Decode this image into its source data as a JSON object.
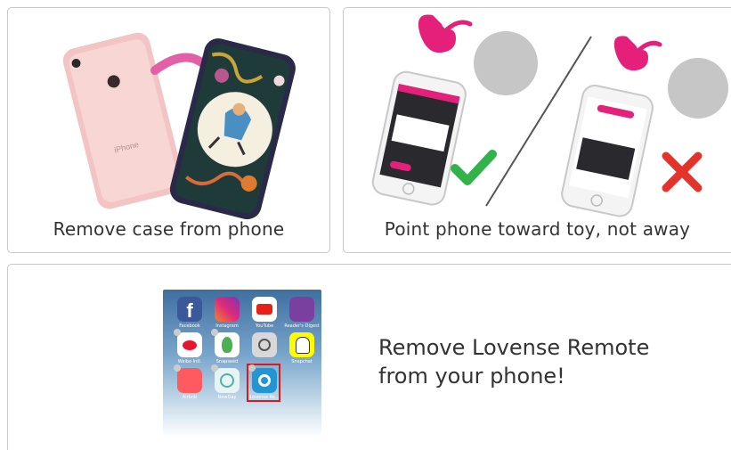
{
  "tips": [
    {
      "caption": "Remove case from phone"
    },
    {
      "caption": "Point phone toward toy, not away"
    }
  ],
  "notice": {
    "message_line1": "Remove Lovense Remote",
    "message_line2": "from your phone!"
  },
  "app_grid": {
    "apps": [
      {
        "label": "Facebook"
      },
      {
        "label": "Instagram"
      },
      {
        "label": "YouTube"
      },
      {
        "label": "Reader's Digest"
      },
      {
        "label": "Weibo Intl."
      },
      {
        "label": "Snapseed"
      },
      {
        "label": ""
      },
      {
        "label": "Snapchat"
      },
      {
        "label": "Airbnb"
      },
      {
        "label": "NewDay"
      },
      {
        "label": "Lovense Re..."
      }
    ],
    "highlighted_app": "Lovense Re..."
  },
  "colors": {
    "toy_pink": "#e4207a",
    "check_green": "#32b34a",
    "cross_red": "#e3332b",
    "highlight_red": "#d41c1c",
    "phone_rose": "#f2c4c4"
  }
}
